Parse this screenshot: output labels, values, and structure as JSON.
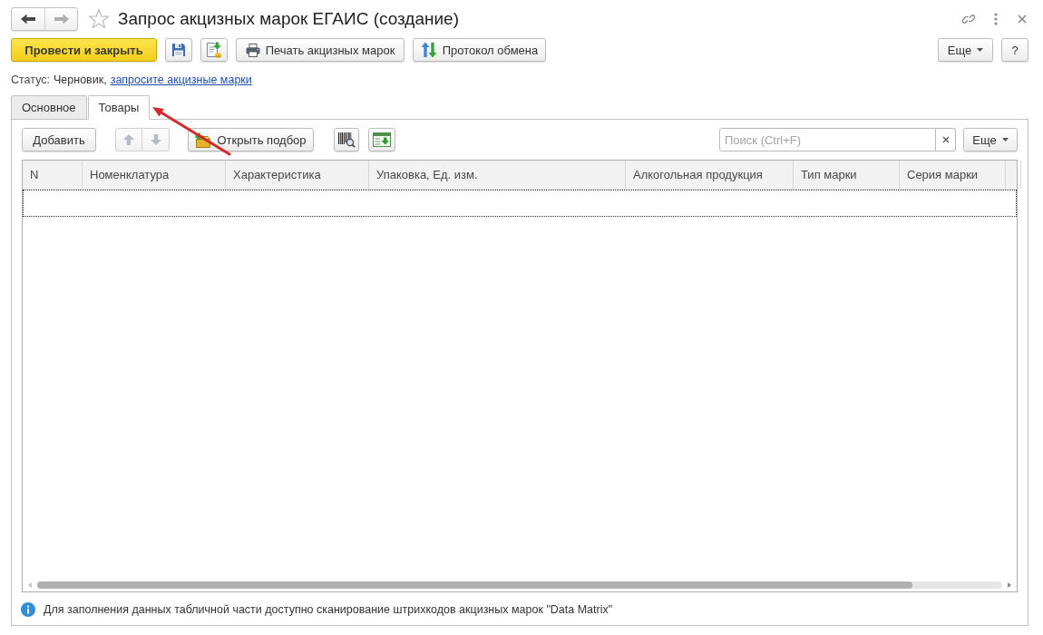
{
  "window": {
    "title": "Запрос акцизных марок ЕГАИС (создание)",
    "favorite": false
  },
  "navigation": [
    {
      "kind": "back",
      "disabled": false
    },
    {
      "kind": "forward",
      "disabled": true
    }
  ],
  "command_bar": {
    "buttons": [
      {
        "kind": "primary",
        "label": "Провести и закрыть"
      },
      {
        "kind": "save"
      },
      {
        "kind": "register"
      },
      {
        "kind": "print",
        "label": "Печать акцизных марок"
      },
      {
        "kind": "protocol",
        "label": "Протокол обмена"
      }
    ],
    "buttons_right": [
      {
        "kind": "menu",
        "label": "Еще"
      },
      {
        "kind": "help",
        "label": "?"
      }
    ]
  },
  "status": {
    "label": "Статус:",
    "value": "Черновик,",
    "link": "запросите акцизные марки"
  },
  "tabs": [
    {
      "label": "Основное",
      "selected": false
    },
    {
      "label": "Товары",
      "selected": true
    }
  ],
  "table_toolbar": {
    "buttons": [
      {
        "kind": "add",
        "label": "Добавить"
      },
      {
        "kind": "up",
        "disabled": true
      },
      {
        "kind": "down",
        "disabled": true
      },
      {
        "kind": "pick",
        "label": "Открыть подбор"
      },
      {
        "kind": "barcode"
      },
      {
        "kind": "load"
      }
    ],
    "search": {
      "placeholder": "Поиск (Ctrl+F)"
    },
    "menu": {
      "label": "Еще"
    }
  },
  "table": {
    "columns": [
      "N",
      "Номенклатура",
      "Характеристика",
      "Упаковка, Ед. изм.",
      "Алкогольная продукция",
      "Тип марки",
      "Серия марки"
    ],
    "rows": [
      {
        "selected": true
      }
    ]
  },
  "hint": "Для заполнения данных табличной части доступно сканирование штрихкодов акцизных марок \"Data Matrix\""
}
